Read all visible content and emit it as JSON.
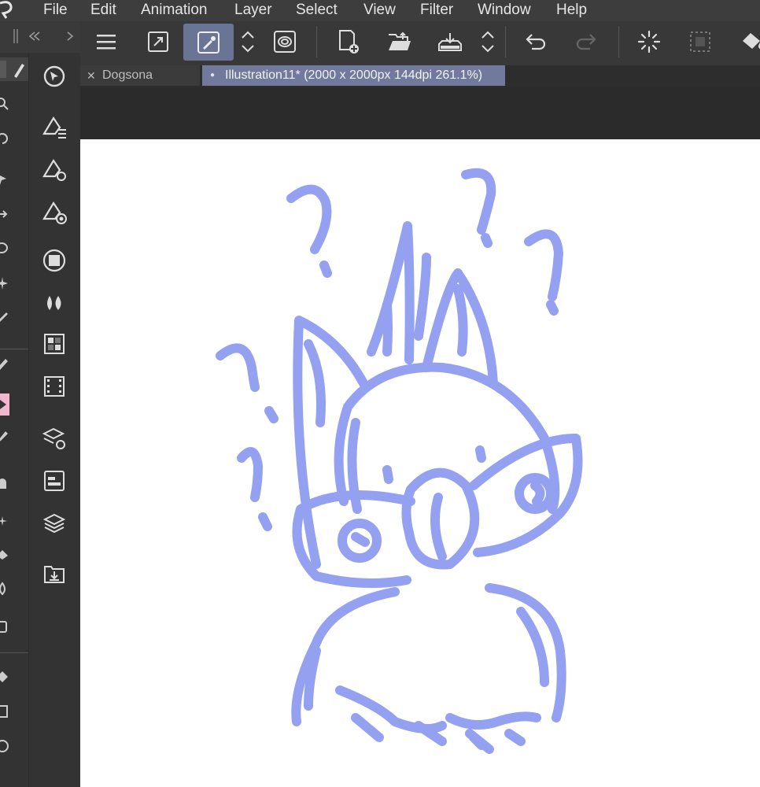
{
  "menu": {
    "items": [
      "File",
      "Edit",
      "Animation",
      "Layer",
      "Select",
      "View",
      "Filter",
      "Window",
      "Help"
    ]
  },
  "tabs": [
    {
      "label": "Dogsona",
      "close": "✕",
      "active": false
    },
    {
      "label": "Illustration11* (2000 x 2000px 144dpi 261.1%)",
      "dot": "●",
      "active": true
    }
  ],
  "toolbar": {
    "icons": [
      "menu-icon",
      "expand-icon",
      "eyedropper-icon",
      "up-down-icon",
      "spiral-icon",
      "new-layer-icon",
      "open-folder-icon",
      "save-icon",
      "up-down-icon",
      "undo-icon",
      "redo-icon",
      "loading-icon",
      "selection-icon",
      "fill-icon"
    ]
  },
  "panel": {
    "icons": [
      "navigator-icon",
      "brush-add-icon",
      "brush-settings-icon",
      "brush-target-icon",
      "square-icon",
      "drops-icon",
      "checker-icon",
      "film-icon",
      "layers-settings-icon",
      "property-icon",
      "layers-icon",
      "import-icon"
    ]
  },
  "colors": {
    "accent": "#717a9c",
    "sketch": "#8f9bf0",
    "menubar": "#3d3d3d"
  }
}
